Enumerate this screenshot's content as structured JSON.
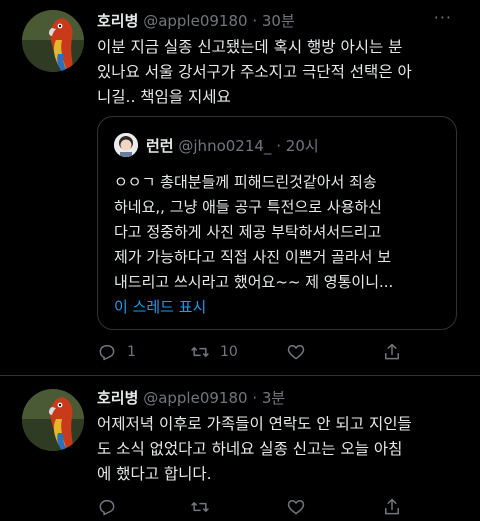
{
  "tweet1": {
    "name": "호리병",
    "handle": "@apple09180",
    "dot": "·",
    "time": "30분",
    "more": "···",
    "lines": [
      "이분 지금 실종 신고됐는데 혹시 행방 아시는 분",
      "있나요 서울 강서구가 주소지고 극단적 선택은 아",
      "니길.. 책임을 지세요"
    ],
    "quote": {
      "name": "런런",
      "handle": "@jhno0214_",
      "dot": "·",
      "time": "20시",
      "lines": [
        "ㅇㅇㄱ 총대분들께 피해드린것같아서 죄송",
        "하네요,, 그냥 애들 공구 특전으로 사용하신",
        "다고 정중하게 사진 제공 부탁하셔서드리고",
        "제가 가능하다고 직접 사진 이쁜거 골라서 보",
        "내드리고 쓰시라고 했어요~~ 제 영통이니..."
      ],
      "show_thread": "이 스레드 표시"
    },
    "actions": {
      "reply_count": "1",
      "retweet_count": "10",
      "like_count": "",
      "share_count": ""
    }
  },
  "tweet2": {
    "name": "호리병",
    "handle": "@apple09180",
    "dot": "·",
    "time": "3분",
    "lines": [
      "어제저녁 이후로 가족들이 연락도 안 되고 지인들",
      "도 소식 없었다고 하네요 실종 신고는 오늘 아침",
      "에 했다고 합니다."
    ]
  },
  "icons": {
    "reply": "reply-icon",
    "retweet": "retweet-icon",
    "like": "heart-icon",
    "share": "share-icon",
    "more": "more-icon"
  },
  "colors": {
    "background": "#000000",
    "text": "#e7e9ea",
    "secondary": "#71767b",
    "link": "#1d9bf0",
    "border": "#2f3336"
  }
}
